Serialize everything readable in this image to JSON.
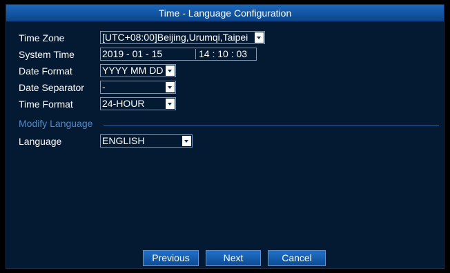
{
  "window": {
    "title": "Time - Language Configuration"
  },
  "form": {
    "time_zone": {
      "label": "Time Zone",
      "value": "[UTC+08:00]Beijing,Urumqi,Taipei"
    },
    "system_time": {
      "label": "System Time",
      "date": "2019 - 01 - 15",
      "time": "14 : 10 : 03"
    },
    "date_format": {
      "label": "Date Format",
      "value": "YYYY MM DD"
    },
    "date_separator": {
      "label": "Date Separator",
      "value": "-"
    },
    "time_format": {
      "label": "Time Format",
      "value": "24-HOUR"
    }
  },
  "language_section": {
    "title": "Modify Language",
    "language": {
      "label": "Language",
      "value": "ENGLISH"
    }
  },
  "buttons": {
    "previous": "Previous",
    "next": "Next",
    "cancel": "Cancel"
  },
  "colors": {
    "panel_background": "#041a33",
    "title_bar": "#1d67ba",
    "field_border": "#6f9fd1",
    "section_text": "#4a8bc9"
  }
}
